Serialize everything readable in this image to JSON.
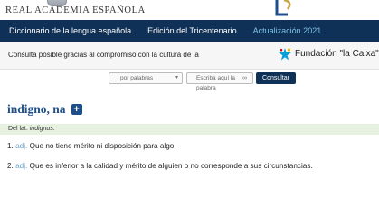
{
  "brand": {
    "name": "REAL ACADEMIA ESPAÑOLA",
    "crest_icon": "crest-icon",
    "logo_icon": "tricentenario-logo-icon"
  },
  "nav": {
    "items": [
      {
        "label": "Diccionario de la lengua española"
      },
      {
        "label": "Edición del Tricentenario"
      },
      {
        "label": "Actualización 2021"
      }
    ]
  },
  "sponsor": {
    "text": "Consulta posible gracias al compromiso con la cultura de la",
    "brand": "Fundación \"la Caixa\"",
    "star_icon": "lacaixa-star-icon"
  },
  "search": {
    "mode_value": "por palabras",
    "query_placeholder": "Escriba aquí la palabra",
    "clear_symbol": "∞",
    "button_label": "Consultar"
  },
  "entry": {
    "headword": "indigno, na",
    "expand_symbol": "+",
    "etymology": {
      "prefix": "Del lat.",
      "latin": "indignus."
    },
    "senses": [
      {
        "num": "1.",
        "abbr": "adj.",
        "text": "Que no tiene mérito ni disposición para algo."
      },
      {
        "num": "2.",
        "abbr": "adj.",
        "text": "Que es inferior a la calidad y mérito de alguien o no corresponde a sus circunstancias."
      }
    ]
  },
  "colors": {
    "nav_bg": "#0f3157",
    "accent_link": "#1f4f8a",
    "etym_bg": "#e6f1e0"
  }
}
